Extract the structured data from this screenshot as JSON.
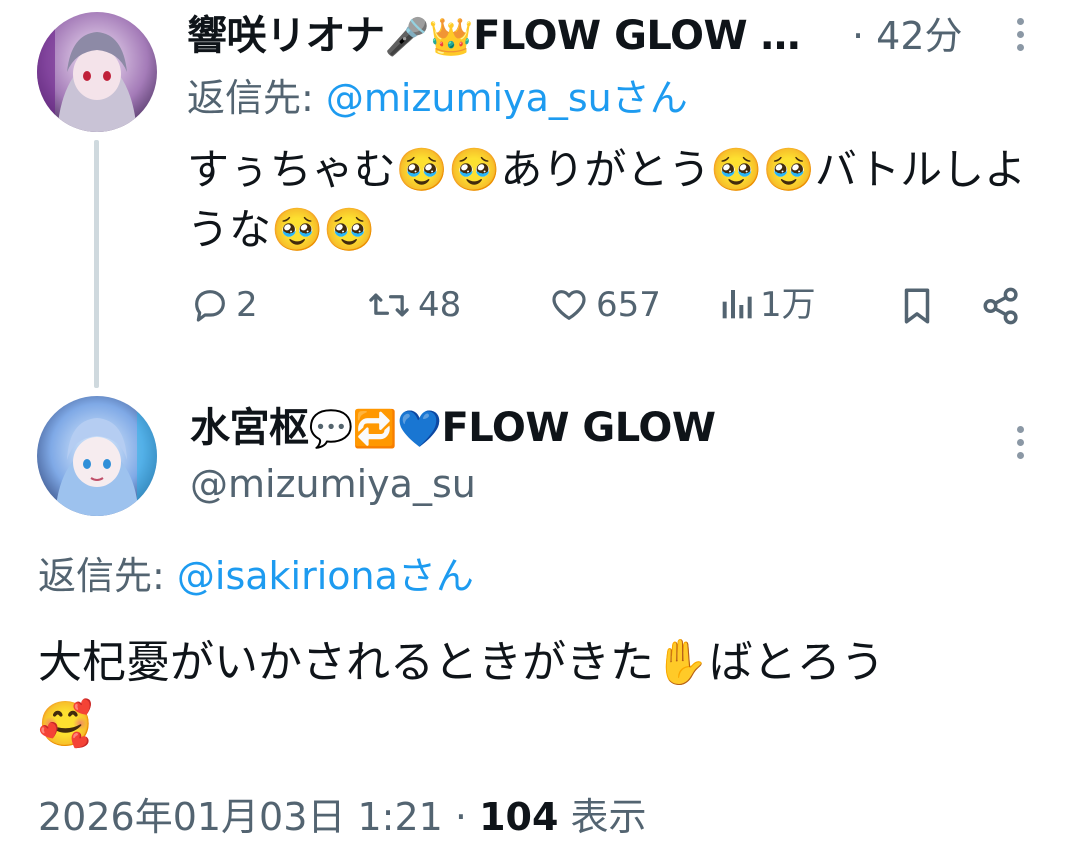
{
  "reply": {
    "display_name": "響咲リオナ",
    "name_emojis": "🎤👑",
    "name_suffix": "FLOW GLOW …",
    "timestamp": "· 42分",
    "reply_to_prefix": "返信先:",
    "reply_to_handle": "@mizumiya_suさん",
    "text_line1": "すぅちゃむ🥹🥹ありがとう🥹🥹バトルしよ",
    "text_line2": "うな🥹🥹",
    "actions": {
      "replies": "2",
      "reposts": "48",
      "likes": "657",
      "views": "1万"
    }
  },
  "main": {
    "display_name": "水宮枢",
    "name_emojis": "💬🔁💙",
    "name_suffix": "FLOW GLOW",
    "handle": "@mizumiya_su",
    "reply_to_prefix": "返信先:",
    "reply_to_handle": "@isakirionaさん",
    "text_line1": "大杞憂がいかされるときがきた✋ばとろう",
    "text_line2": "🥰",
    "footer": {
      "datetime": "2026年01月03日 1:21 ·",
      "views_count": "104",
      "views_label": "表示"
    }
  },
  "colors": {
    "link": "#1d9bf0",
    "muted": "#536471",
    "text": "#0f1419",
    "thread_line": "#cfd9de"
  }
}
